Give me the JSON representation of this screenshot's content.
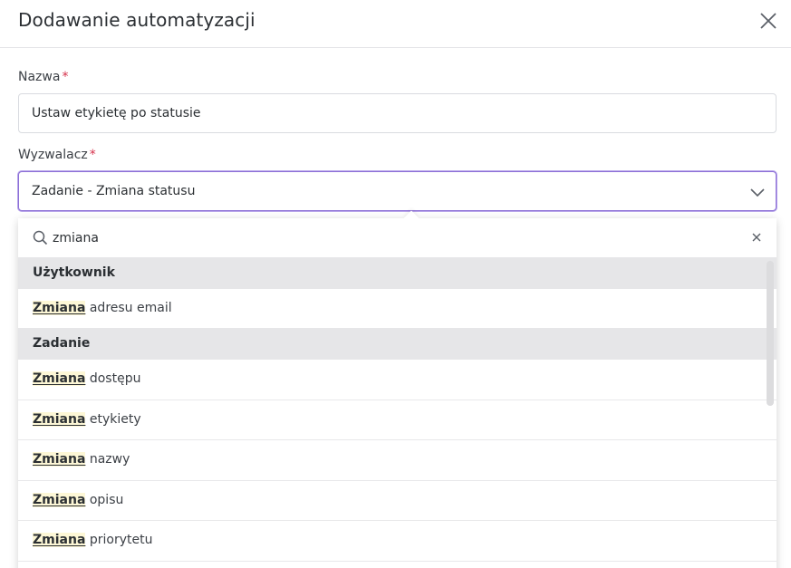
{
  "modal": {
    "title": "Dodawanie automatyzacji"
  },
  "form": {
    "name": {
      "label": "Nazwa",
      "required_mark": "*",
      "value": "Ustaw etykietę po statusie"
    },
    "trigger": {
      "label": "Wyzwalacz",
      "required_mark": "*",
      "value": "Zadanie - Zmiana statusu"
    }
  },
  "dropdown": {
    "search_value": "zmiana",
    "groups": [
      {
        "label": "Użytkownik",
        "options": [
          {
            "match": "Zmiana",
            "rest": " adresu email"
          }
        ]
      },
      {
        "label": "Zadanie",
        "options": [
          {
            "match": "Zmiana",
            "rest": " dostępu"
          },
          {
            "match": "Zmiana",
            "rest": " etykiety"
          },
          {
            "match": "Zmiana",
            "rest": " nazwy"
          },
          {
            "match": "Zmiana",
            "rest": " opisu"
          },
          {
            "match": "Zmiana",
            "rest": " priorytetu"
          }
        ]
      }
    ]
  },
  "icons": {
    "close": "close-icon",
    "chevron": "chevron-down-icon",
    "search": "search-icon",
    "clear": "clear-icon"
  },
  "colors": {
    "focus_border": "#8c6fd6",
    "required": "#d6304a",
    "match_highlight": "#fdf7d6",
    "group_bg": "#e6e6e8"
  }
}
